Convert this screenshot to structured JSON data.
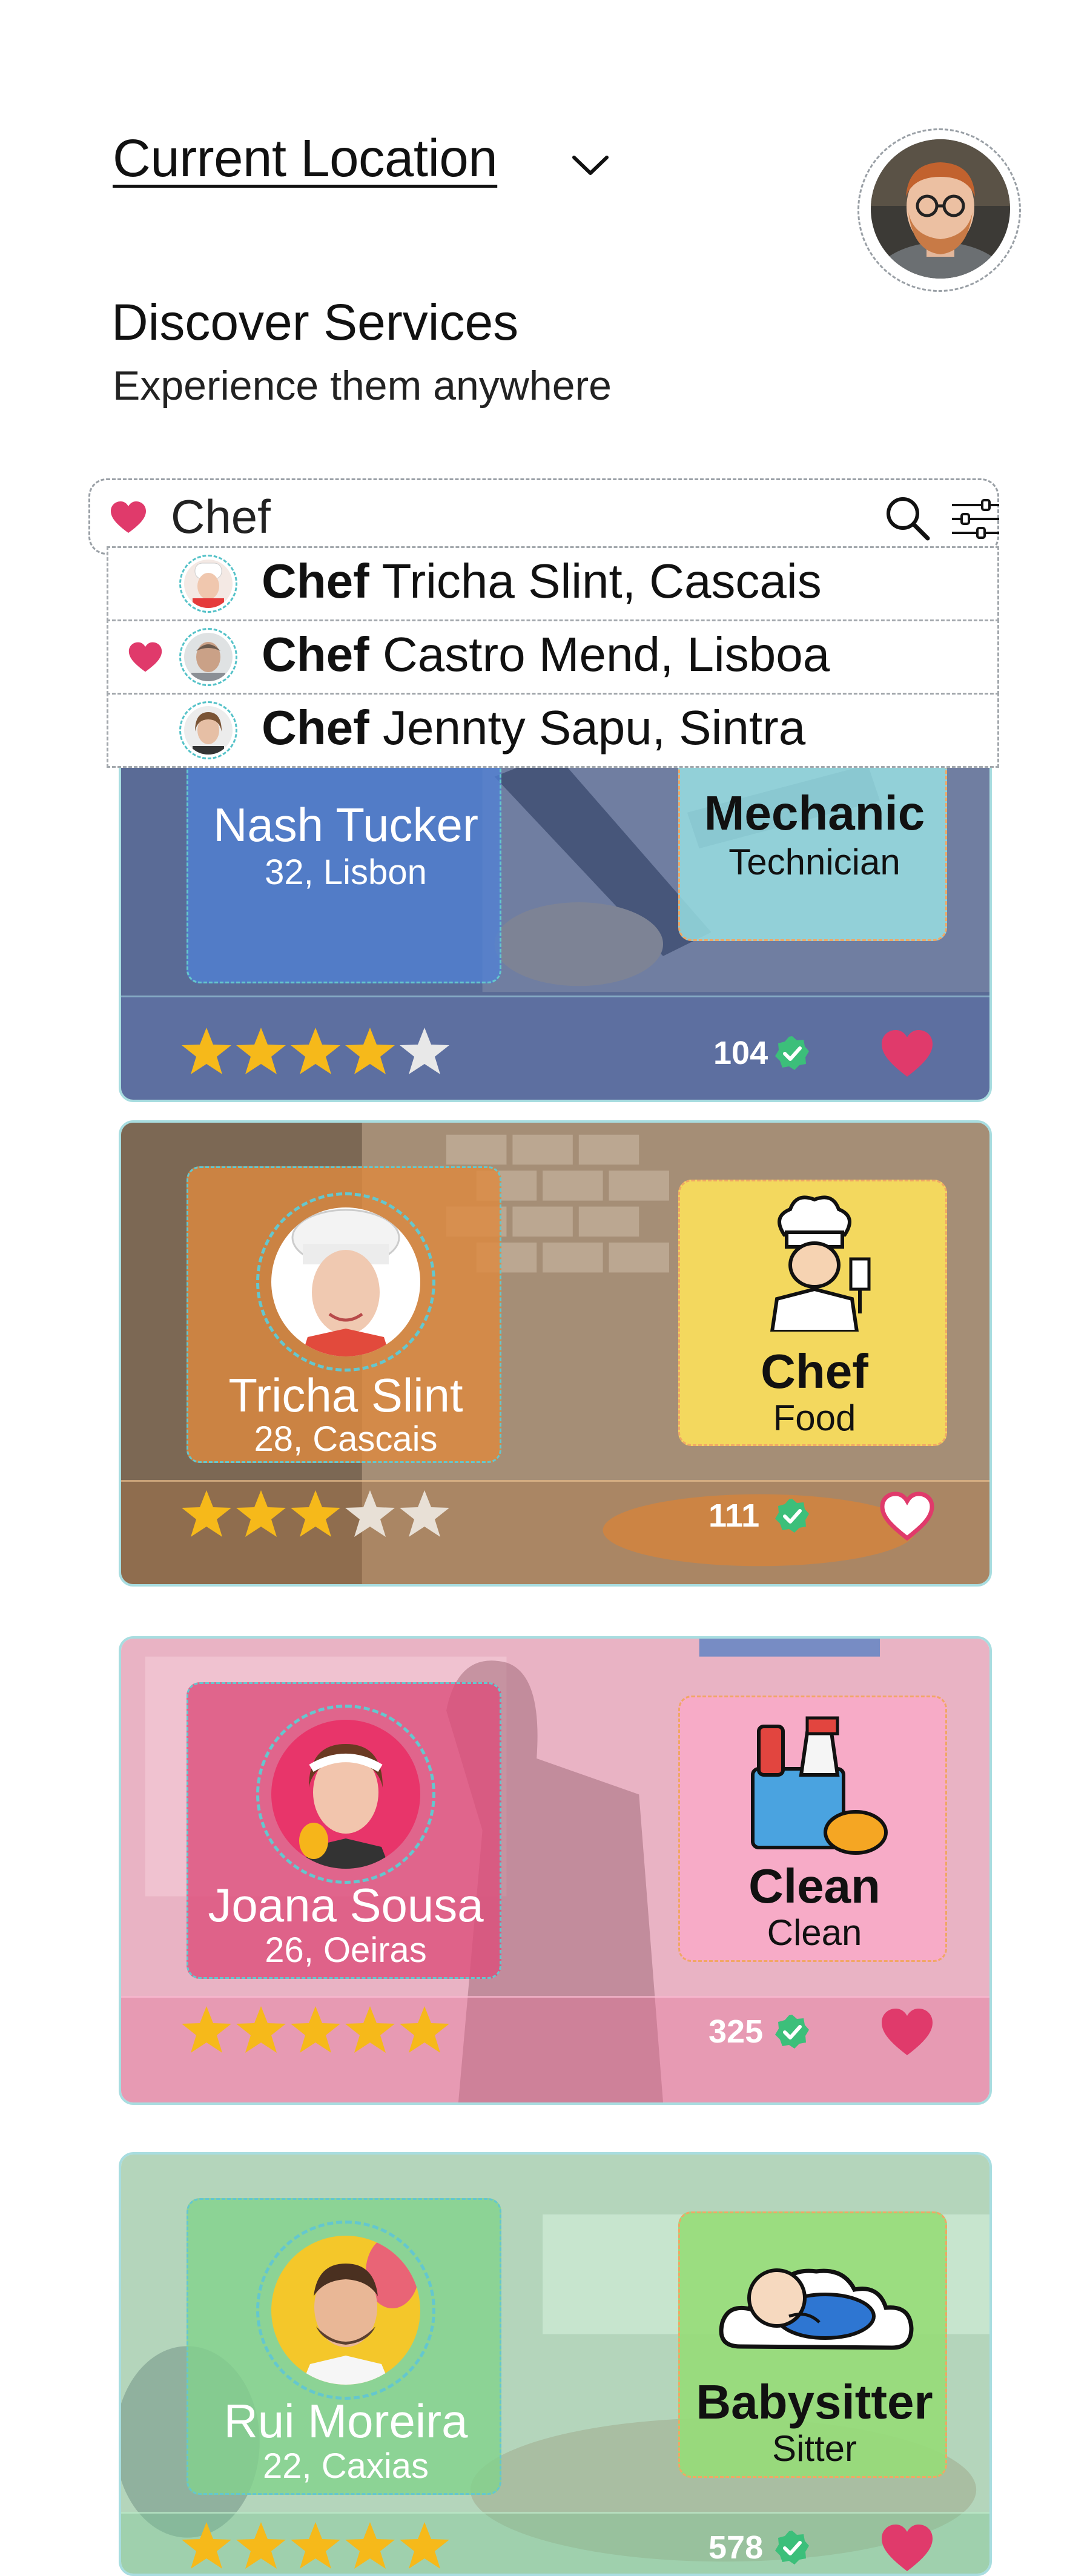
{
  "header": {
    "location_label": "Current Location",
    "title": "Discover Services",
    "subtitle": "Experience them anywhere"
  },
  "search": {
    "value": "Chef",
    "suggestions": [
      {
        "keyword": "Chef",
        "rest": "Tricha Slint, Cascais",
        "favorite": false
      },
      {
        "keyword": "Chef",
        "rest": "Castro Mend, Lisboa",
        "favorite": true
      },
      {
        "keyword": "Chef",
        "rest": "Jennty Sapu, Sintra",
        "favorite": false
      }
    ]
  },
  "cards": [
    {
      "name": "Nash Tucker",
      "meta": "32, Lisbon",
      "service": "Mechanic",
      "category": "Technician",
      "rating": 4,
      "reviews": "104",
      "favorite": true
    },
    {
      "name": "Tricha Slint",
      "meta": "28, Cascais",
      "service": "Chef",
      "category": "Food",
      "rating": 3,
      "reviews": "111",
      "favorite": false
    },
    {
      "name": "Joana Sousa",
      "meta": "26, Oeiras",
      "service": "Clean",
      "category": "Clean",
      "rating": 5,
      "reviews": "325",
      "favorite": true
    },
    {
      "name": "Rui Moreira",
      "meta": "22, Caxias",
      "service": "Babysitter",
      "category": "Sitter",
      "rating": 5,
      "reviews": "578",
      "favorite": true
    }
  ],
  "colors": {
    "accent_heart": "#e03a6b",
    "star": "#f6b91a",
    "verified": "#3cbf7a",
    "outline": "#64c7ce"
  }
}
